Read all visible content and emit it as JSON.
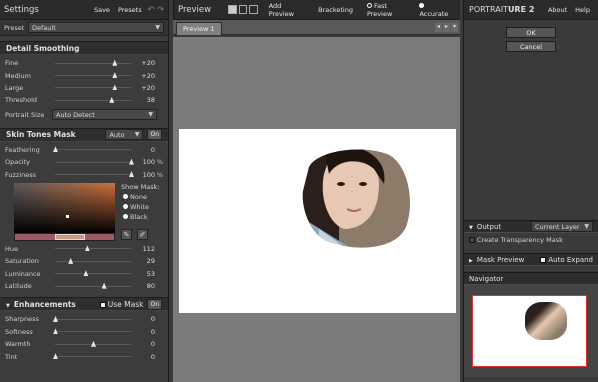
{
  "left": {
    "title": "Settings",
    "save": "Save",
    "presets": "Presets",
    "undo": "↶",
    "redo": "↷",
    "preset_label": "Preset",
    "preset_value": "Default",
    "detail": {
      "title": "Detail Smoothing",
      "rows": [
        {
          "label": "Fine",
          "value": "+20",
          "pct": 0.78
        },
        {
          "label": "Medium",
          "value": "+20",
          "pct": 0.78
        },
        {
          "label": "Large",
          "value": "+20",
          "pct": 0.78
        },
        {
          "label": "Threshold",
          "value": "38",
          "pct": 0.74
        }
      ],
      "size_label": "Portrait Size",
      "size_value": "Auto Detect"
    },
    "skin": {
      "title": "Skin Tones Mask",
      "mode": "Auto",
      "on": "On",
      "rows": [
        {
          "label": "Feathering",
          "value": "0",
          "unit": "",
          "pct": 0.0
        },
        {
          "label": "Opacity",
          "value": "100",
          "unit": "%",
          "pct": 1.0
        },
        {
          "label": "Fuzziness",
          "value": "100",
          "unit": "%",
          "pct": 1.0
        }
      ],
      "show_mask_label": "Show Mask:",
      "show_opts": [
        "None",
        "White",
        "Black"
      ],
      "rows2": [
        {
          "label": "Hue",
          "value": "112",
          "pct": 0.42
        },
        {
          "label": "Saturation",
          "value": "29",
          "pct": 0.2
        },
        {
          "label": "Luminance",
          "value": "53",
          "pct": 0.4
        },
        {
          "label": "Latitude",
          "value": "80",
          "pct": 0.64
        }
      ]
    },
    "enh": {
      "title": "Enhancements",
      "usemask": "Use Mask",
      "on": "On",
      "rows": [
        {
          "label": "Sharpness",
          "value": "0"
        },
        {
          "label": "Softness",
          "value": "0"
        },
        {
          "label": "Warmth",
          "value": "0",
          "pct": 0.5
        },
        {
          "label": "Tint",
          "value": "0"
        }
      ]
    }
  },
  "mid": {
    "title": "Preview",
    "add_preview": "Add Preview",
    "bracketing": "Bracketing",
    "fast": "Fast Preview",
    "accurate": "Accurate",
    "tab": "Preview 1"
  },
  "right": {
    "brand_a": "PORTRAIT",
    "brand_b": "URE 2",
    "about": "About",
    "help": "Help",
    "ok": "OK",
    "cancel": "Cancel",
    "output_title": "Output",
    "output_sel": "Current Layer",
    "create_mask": "Create Transparency Mask",
    "mask_preview": "Mask Preview",
    "auto_expand": "Auto Expand",
    "navigator": "Navigator"
  }
}
